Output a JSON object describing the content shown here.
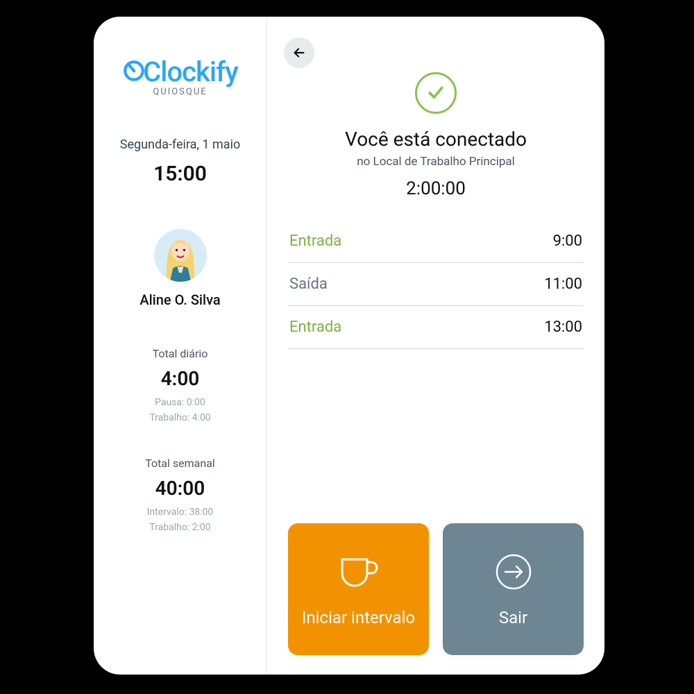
{
  "brand": {
    "name": "Clockify",
    "subtitle": "QUIOSQUE"
  },
  "sidebar": {
    "date": "Segunda-feira, 1 maio",
    "time": "15:00",
    "user": "Aline O. Silva",
    "daily": {
      "label": "Total diário",
      "value": "4:00",
      "break": "Pausa: 0:00",
      "work": "Trabalho: 4:00"
    },
    "weekly": {
      "label": "Total semanal",
      "value": "40:00",
      "break": "Intervalo: 38:00",
      "work": "Trabalho: 2:00"
    }
  },
  "status": {
    "title": "Você está conectado",
    "subtitle": "no Local de Trabalho Principal",
    "elapsed": "2:00:00"
  },
  "log": [
    {
      "label": "Entrada",
      "type": "in",
      "time": "9:00"
    },
    {
      "label": "Saída",
      "type": "out",
      "time": "11:00"
    },
    {
      "label": "Entrada",
      "type": "in",
      "time": "13:00"
    }
  ],
  "actions": {
    "break": "Iniciar intervalo",
    "exit": "Sair"
  }
}
